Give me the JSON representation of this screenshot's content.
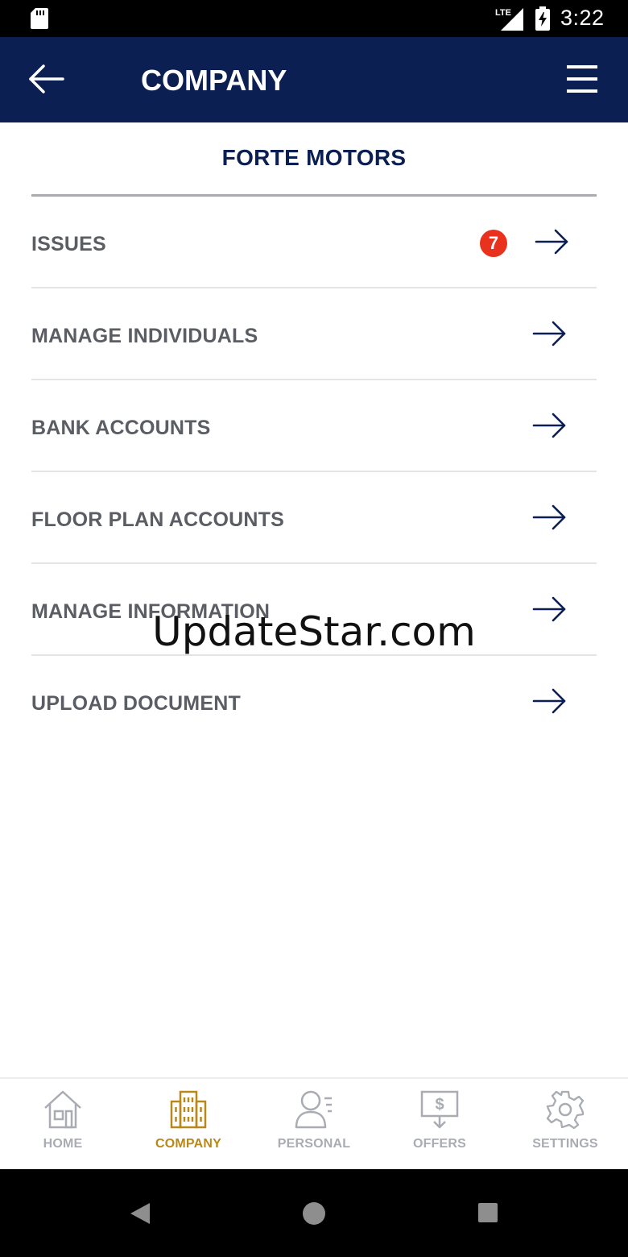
{
  "status_bar": {
    "network": "LTE",
    "time": "3:22"
  },
  "app_bar": {
    "title": "COMPANY",
    "back_icon": "arrow-left-icon",
    "menu_icon": "hamburger-menu-icon"
  },
  "company": {
    "name": "FORTE MOTORS"
  },
  "menu": {
    "items": [
      {
        "label": "ISSUES",
        "badge": "7"
      },
      {
        "label": "MANAGE INDIVIDUALS"
      },
      {
        "label": "BANK ACCOUNTS"
      },
      {
        "label": "FLOOR PLAN ACCOUNTS"
      },
      {
        "label": "MANAGE INFORMATION"
      },
      {
        "label": "UPLOAD DOCUMENT"
      }
    ],
    "row_icon": "arrow-right-icon"
  },
  "watermark": "UpdateStar.com",
  "bottom_nav": {
    "items": [
      {
        "label": "HOME",
        "icon": "home-icon"
      },
      {
        "label": "COMPANY",
        "icon": "building-icon",
        "active": true
      },
      {
        "label": "PERSONAL",
        "icon": "person-icon"
      },
      {
        "label": "OFFERS",
        "icon": "offers-icon"
      },
      {
        "label": "SETTINGS",
        "icon": "gear-icon"
      }
    ]
  },
  "colors": {
    "primary": "#0b1f52",
    "accent": "#b8881a",
    "badge": "#e8321e",
    "inactive": "#a9acb2",
    "text": "#5a5d63"
  }
}
